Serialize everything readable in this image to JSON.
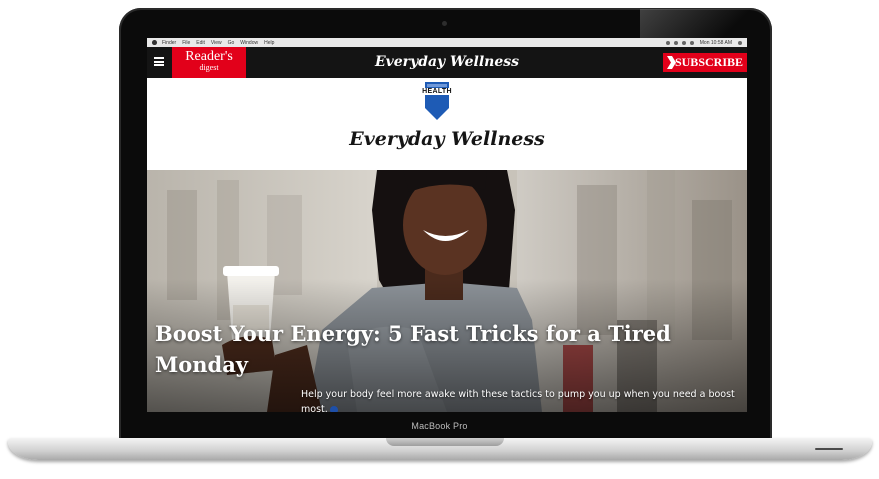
{
  "device": {
    "label": "MacBook Pro"
  },
  "menubar": {
    "items": [
      "Finder",
      "File",
      "Edit",
      "View",
      "Go",
      "Window",
      "Help"
    ],
    "clock": "Mon 10:58 AM"
  },
  "header": {
    "logo_line1": "Reader's",
    "logo_line2": "digest",
    "title": "Everyday Wellness",
    "subscribe_label": "SUBSCRIBE"
  },
  "section": {
    "badge_label": "HEALTH",
    "title": "Everyday Wellness"
  },
  "hero": {
    "headline": "Boost Your Energy: 5 Fast Tricks for a Tired Monday",
    "dek": "Help your body feel more awake with these tactics to pump you up when you need a boost most."
  },
  "colors": {
    "brand_red": "#e2001a",
    "header_bg": "#141414",
    "badge_blue": "#1e5bb5"
  },
  "icons": [
    "menu-icon",
    "apple-icon",
    "chevron-right-icon",
    "ribbon-badge-icon",
    "read-more-dot-icon"
  ]
}
